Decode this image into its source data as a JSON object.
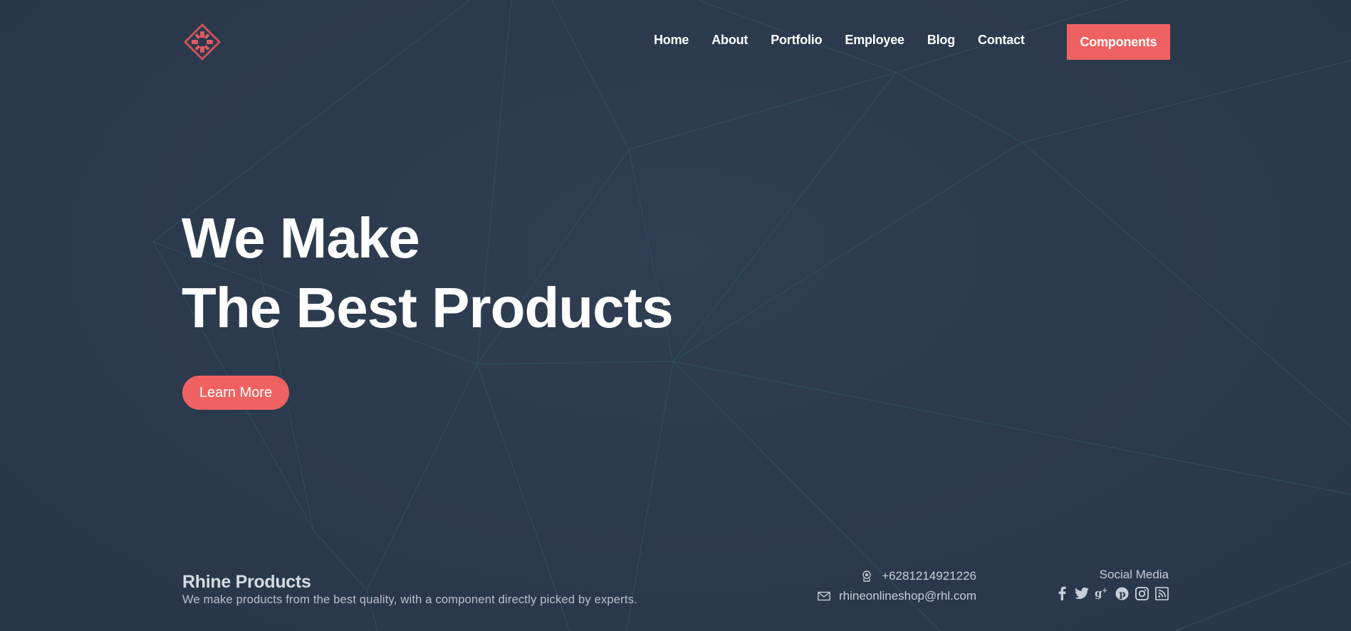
{
  "header": {
    "logo_icon": "diamond-logo-icon",
    "nav": [
      {
        "label": "Home"
      },
      {
        "label": "About"
      },
      {
        "label": "Portfolio"
      },
      {
        "label": "Employee"
      },
      {
        "label": "Blog"
      },
      {
        "label": "Contact"
      }
    ],
    "cta_label": "Components"
  },
  "hero": {
    "line1": "We Make",
    "line2": "The Best Products",
    "button_label": "Learn More"
  },
  "footer": {
    "brand_name": "Rhine Products",
    "brand_desc": "We make products from the best quality, with a component directly picked by experts.",
    "phone": "+6281214921226",
    "email": "rhineonlineshop@rhl.com",
    "social_title": "Social Media",
    "social_icons": [
      "facebook-icon",
      "twitter-icon",
      "google-plus-icon",
      "pinterest-icon",
      "instagram-icon",
      "rss-icon"
    ]
  },
  "colors": {
    "background": "#2d3b4e",
    "accent": "#f06262",
    "text": "#ffffff"
  }
}
